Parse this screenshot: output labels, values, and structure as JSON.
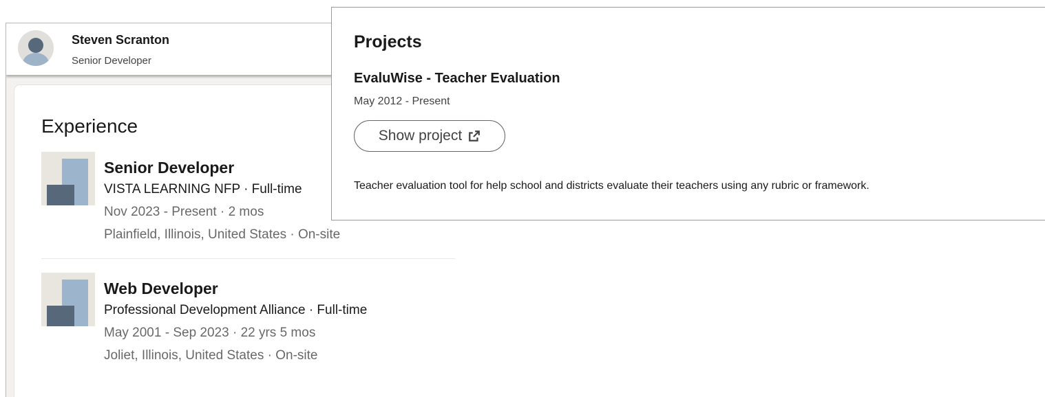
{
  "profile": {
    "name": "Steven Scranton",
    "headline": "Senior Developer"
  },
  "experience": {
    "title": "Experience",
    "items": [
      {
        "title": "Senior Developer",
        "company": "VISTA LEARNING NFP · Full-time",
        "dates": "Nov 2023 - Present · 2 mos",
        "location": "Plainfield, Illinois, United States · On-site"
      },
      {
        "title": "Web Developer",
        "company": "Professional Development Alliance · Full-time",
        "dates": "May 2001 - Sep 2023 · 22 yrs 5 mos",
        "location": "Joliet, Illinois, United States · On-site"
      }
    ]
  },
  "projects": {
    "title": "Projects",
    "name": "EvaluWise - Teacher Evaluation",
    "dates": "May 2012 - Present",
    "show_label": "Show project",
    "show_icon": "external-link-icon",
    "description": "Teacher evaluation tool for help school and districts evaluate their teachers using any rubric or framework."
  }
}
